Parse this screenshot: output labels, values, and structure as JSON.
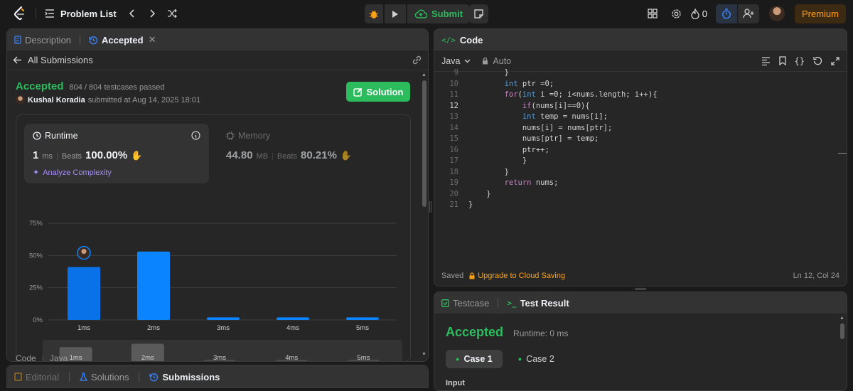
{
  "topbar": {
    "problem_list": "Problem List",
    "submit": "Submit",
    "streak": "0",
    "premium": "Premium"
  },
  "left_panel": {
    "tabs": [
      {
        "label": "Description"
      },
      {
        "label": "Accepted"
      }
    ],
    "all_submissions": "All Submissions",
    "status": "Accepted",
    "testcases": "804 / 804 testcases passed",
    "user": "Kushal Koradia",
    "submitted_at": "submitted at Aug 14, 2025 18:01",
    "solution_button": "Solution",
    "runtime": {
      "label": "Runtime",
      "value": "1",
      "unit": "ms",
      "beats_label": "Beats",
      "percent": "100.00%",
      "analyze": "Analyze Complexity"
    },
    "memory": {
      "label": "Memory",
      "value": "44.80",
      "unit": "MB",
      "beats_label": "Beats",
      "percent": "80.21%"
    },
    "code_lang_label": "Code",
    "code_lang": "Java"
  },
  "chart_data": {
    "type": "bar",
    "categories": [
      "1ms",
      "2ms",
      "3ms",
      "4ms",
      "5ms"
    ],
    "values": [
      41,
      53,
      2,
      2,
      2
    ],
    "ylim": [
      0,
      75
    ],
    "yticks": [
      "75%",
      "50%",
      "25%",
      "0%"
    ],
    "highlight_index": 0,
    "overview_values": [
      37,
      46,
      4,
      4,
      4
    ],
    "overview_labels": [
      "1ms",
      "2ms",
      "3ms",
      "4ms",
      "5ms"
    ]
  },
  "bottom_tabs": [
    {
      "label": "Editorial"
    },
    {
      "label": "Solutions"
    },
    {
      "label": "Submissions"
    }
  ],
  "code_panel": {
    "title": "Code",
    "language": "Java",
    "auto": "Auto",
    "saved": "Saved",
    "upgrade": "Upgrade to Cloud Saving",
    "cursor": "Ln 12, Col 24",
    "current_line": 12,
    "lines": [
      {
        "n": "9",
        "text": "        }"
      },
      {
        "n": "10",
        "text": "        int ptr =0;"
      },
      {
        "n": "11",
        "text": "        for(int i =0; i<nums.length; i++){"
      },
      {
        "n": "12",
        "text": "            if(nums[i]==0){"
      },
      {
        "n": "13",
        "text": "            int temp = nums[i];"
      },
      {
        "n": "14",
        "text": "            nums[i] = nums[ptr];"
      },
      {
        "n": "15",
        "text": "            nums[ptr] = temp;"
      },
      {
        "n": "16",
        "text": "            ptr++;"
      },
      {
        "n": "17",
        "text": "            }"
      },
      {
        "n": "18",
        "text": "        }"
      },
      {
        "n": "19",
        "text": "        return nums;"
      },
      {
        "n": "20",
        "text": "    }"
      },
      {
        "n": "21",
        "text": "}"
      }
    ]
  },
  "test_panel": {
    "testcase_tab": "Testcase",
    "result_tab": "Test Result",
    "status": "Accepted",
    "runtime": "Runtime: 0 ms",
    "cases": [
      "Case 1",
      "Case 2"
    ],
    "input_label": "Input"
  },
  "colors": {
    "accent_green": "#2cbb5d",
    "bar_blue": "#0a84ff",
    "premium": "#ffa116",
    "link_blue": "#3b82f6"
  }
}
